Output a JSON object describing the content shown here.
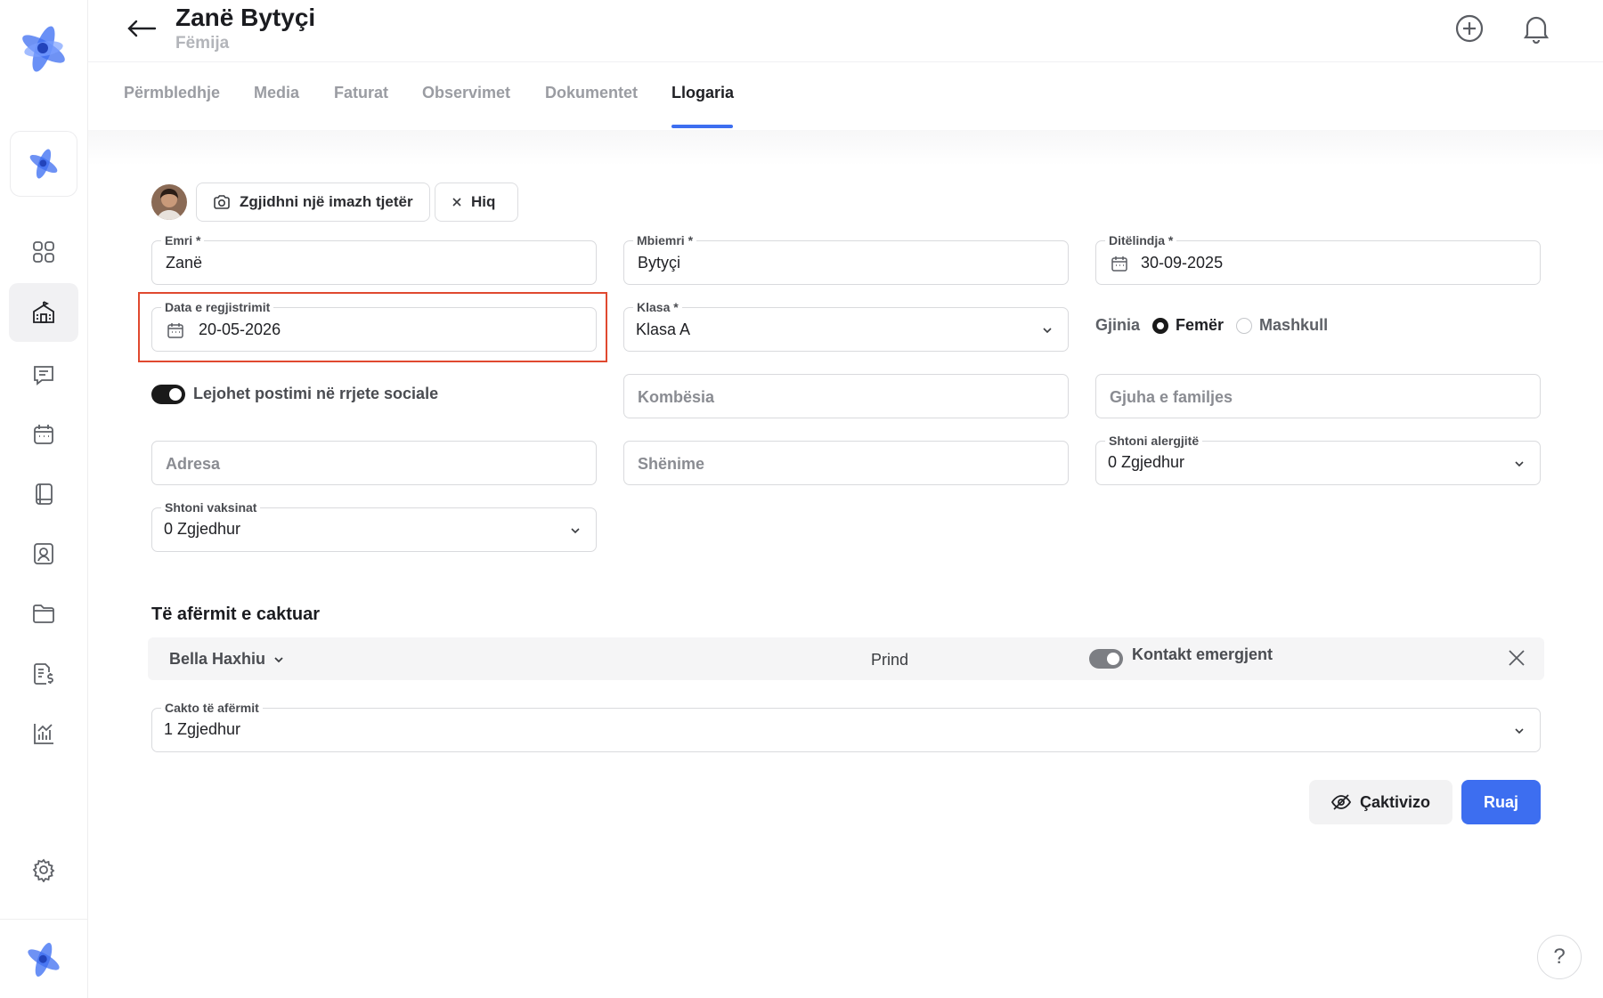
{
  "header": {
    "title": "Zanë Bytyçi",
    "subtitle": "Fëmija"
  },
  "tabs": [
    {
      "label": "Përmbledhje"
    },
    {
      "label": "Media"
    },
    {
      "label": "Faturat"
    },
    {
      "label": "Observimet"
    },
    {
      "label": "Dokumentet"
    },
    {
      "label": "Llogaria",
      "active": true
    }
  ],
  "sidebar": {
    "items": [
      {
        "icon": "dashboard-icon"
      },
      {
        "icon": "school-icon",
        "active": true
      },
      {
        "icon": "messages-icon"
      },
      {
        "icon": "calendar-icon"
      },
      {
        "icon": "notebook-icon"
      },
      {
        "icon": "contacts-icon"
      },
      {
        "icon": "folder-icon"
      },
      {
        "icon": "billing-icon"
      },
      {
        "icon": "reports-icon"
      },
      {
        "icon": "settings-icon"
      }
    ]
  },
  "avatar_actions": {
    "choose_image": "Zgjidhni një imazh tjetër",
    "remove": "Hiq"
  },
  "form": {
    "first_name": {
      "label": "Emri *",
      "value": "Zanë"
    },
    "last_name": {
      "label": "Mbiemri *",
      "value": "Bytyçi"
    },
    "birthdate": {
      "label": "Ditëlindja *",
      "value": "30-09-2025"
    },
    "registration_date": {
      "label": "Data e regjistrimit",
      "value": "20-05-2026"
    },
    "class": {
      "label": "Klasa *",
      "value": "Klasa A"
    },
    "gender": {
      "label": "Gjinia",
      "options": [
        "Femër",
        "Mashkull"
      ],
      "selected": "Femër"
    },
    "social_posting": {
      "label": "Lejohet postimi në rrjete sociale",
      "enabled": true
    },
    "nationality": {
      "placeholder": "Kombësia"
    },
    "family_language": {
      "placeholder": "Gjuha e familjes"
    },
    "address": {
      "placeholder": "Adresa"
    },
    "notes": {
      "placeholder": "Shënime"
    },
    "allergies": {
      "label": "Shtoni alergjitë",
      "value": "0 Zgjedhur"
    },
    "vaccines": {
      "label": "Shtoni vaksinat",
      "value": "0 Zgjedhur"
    }
  },
  "relatives": {
    "title": "Të afërmit e caktuar",
    "rows": [
      {
        "name": "Bella Haxhiu",
        "role": "Prind",
        "emergency_label": "Kontakt emergjent",
        "emergency": true
      }
    ],
    "assign": {
      "label": "Cakto të afërmit",
      "value": "1 Zgjedhur"
    }
  },
  "actions": {
    "deactivate": "Çaktivizo",
    "save": "Ruaj"
  },
  "help": "?",
  "colors": {
    "accent": "#3d6ef0",
    "highlight": "#e0492f",
    "logo": "#4f7df5"
  }
}
